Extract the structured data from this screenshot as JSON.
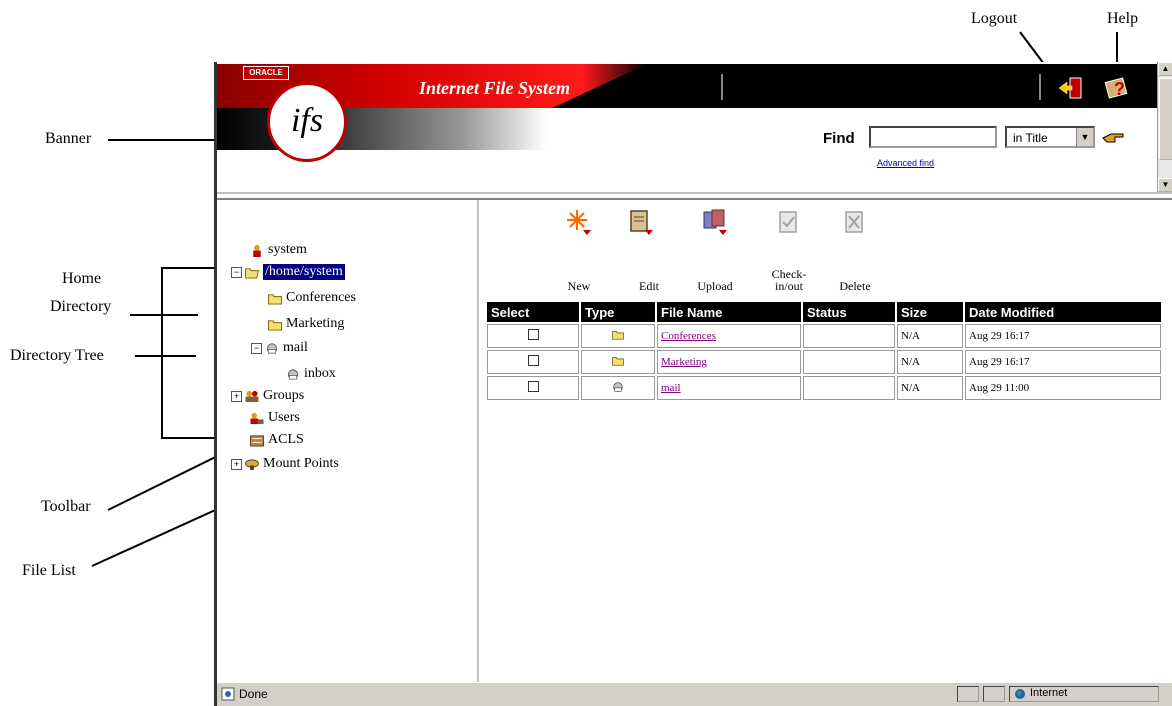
{
  "callouts": {
    "logout": "Logout",
    "help": "Help",
    "banner": "Banner",
    "home_directory_line1": "Home",
    "home_directory_line2": "Directory",
    "directory_tree": "Directory Tree",
    "toolbar": "Toolbar",
    "file_list": "File List"
  },
  "banner": {
    "oracle": "ORACLE",
    "logo": "ifs",
    "app_title": "Internet File System",
    "logout_icon": "logout-icon",
    "help_icon": "help-icon"
  },
  "find": {
    "label": "Find",
    "value": "",
    "scope": "in Title",
    "advanced_link": "Advanced find"
  },
  "tree": {
    "items": [
      {
        "label": "system",
        "icon": "user-icon"
      },
      {
        "label": "/home/system",
        "icon": "open-folder-icon",
        "selected": true
      },
      {
        "label": "Conferences",
        "icon": "folder-icon"
      },
      {
        "label": "Marketing",
        "icon": "folder-icon"
      },
      {
        "label": "mail",
        "icon": "mail-icon"
      },
      {
        "label": "inbox",
        "icon": "mail-icon"
      },
      {
        "label": "Groups",
        "icon": "groups-icon"
      },
      {
        "label": "Users",
        "icon": "users-icon"
      },
      {
        "label": "ACLS",
        "icon": "acls-icon"
      },
      {
        "label": "Mount Points",
        "icon": "mount-points-icon"
      }
    ]
  },
  "toolbar": {
    "new": "New",
    "edit": "Edit",
    "upload": "Upload",
    "checkinout_1": "Check-",
    "checkinout_2": "in/out",
    "delete": "Delete"
  },
  "file_table": {
    "headers": [
      "Select",
      "Type",
      "File Name",
      "Status",
      "Size",
      "Date Modified"
    ],
    "rows": [
      {
        "name": "Conferences",
        "type_icon": "folder-icon",
        "status": "",
        "size": "N/A",
        "date": "Aug 29 16:17"
      },
      {
        "name": "Marketing",
        "type_icon": "folder-icon",
        "status": "",
        "size": "N/A",
        "date": "Aug 29 16:17"
      },
      {
        "name": "mail",
        "type_icon": "mail-icon",
        "status": "",
        "size": "N/A",
        "date": "Aug 29 11:00"
      }
    ]
  },
  "statusbar": {
    "status": "Done",
    "zone": "Internet"
  }
}
